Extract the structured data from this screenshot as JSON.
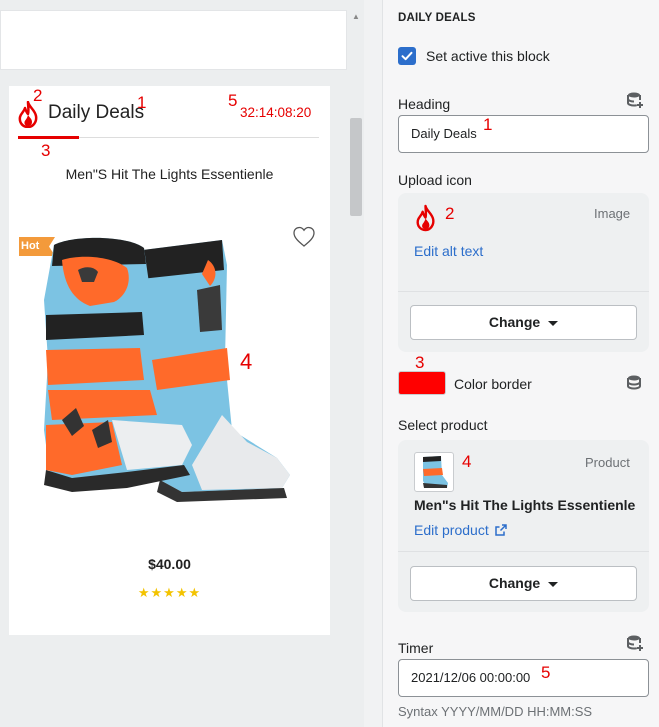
{
  "preview": {
    "title": "Daily Deals",
    "timer": "32:14:08:20",
    "product_name": "Men\"S Hit The Lights Essentienle",
    "badge": "Hot",
    "price": "$40.00",
    "stars": "★★★★★",
    "rating": 5,
    "icons": {
      "fire": "fire-icon",
      "heart": "heart-icon"
    },
    "accent_color": "#e60000"
  },
  "annotations": {
    "preview_title": "1",
    "preview_icon": "2",
    "preview_border": "3",
    "preview_product": "4",
    "preview_timer": "5",
    "heading_input": "1",
    "icon_card": "2",
    "color_border": "3",
    "product_card": "4",
    "timer_input": "5"
  },
  "settings": {
    "section_title": "DAILY DEALS",
    "active_checkbox": {
      "label": "Set active this block",
      "checked": true
    },
    "heading": {
      "label": "Heading",
      "value": "Daily Deals"
    },
    "upload_icon": {
      "label": "Upload icon",
      "type_label": "Image",
      "edit_link": "Edit alt text",
      "change_label": "Change"
    },
    "color_border": {
      "label": "Color border",
      "value": "#ff0000"
    },
    "select_product": {
      "label": "Select product",
      "type_label": "Product",
      "product_title": "Men\"s Hit The Lights Essentienle",
      "edit_link": "Edit product",
      "change_label": "Change"
    },
    "timer": {
      "label": "Timer",
      "value": "2021/12/06 00:00:00",
      "hint": "Syntax YYYY/MM/DD HH:MM:SS"
    }
  }
}
